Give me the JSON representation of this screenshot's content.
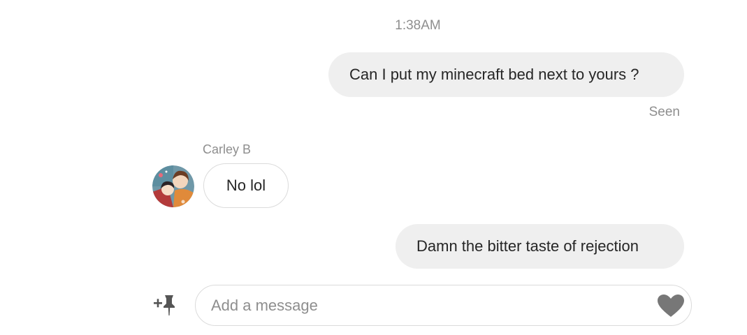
{
  "thread": {
    "timestamp": "1:38AM",
    "messages": [
      {
        "direction": "outgoing",
        "text": "Can I put my minecraft bed next to yours ?"
      },
      {
        "direction": "incoming",
        "sender": "Carley B",
        "text": "No lol"
      },
      {
        "direction": "outgoing",
        "text": "Damn the bitter taste of rejection"
      }
    ],
    "seen_label": "Seen"
  },
  "composer": {
    "placeholder": "Add a message",
    "value": "",
    "pin_icon": "plus-pin-icon",
    "like_icon": "heart-icon"
  },
  "colors": {
    "outgoing_bubble": "#efefef",
    "incoming_border": "#dbdbdb",
    "meta_text": "#8e8e8e",
    "message_text": "#262626",
    "heart": "#777777"
  }
}
